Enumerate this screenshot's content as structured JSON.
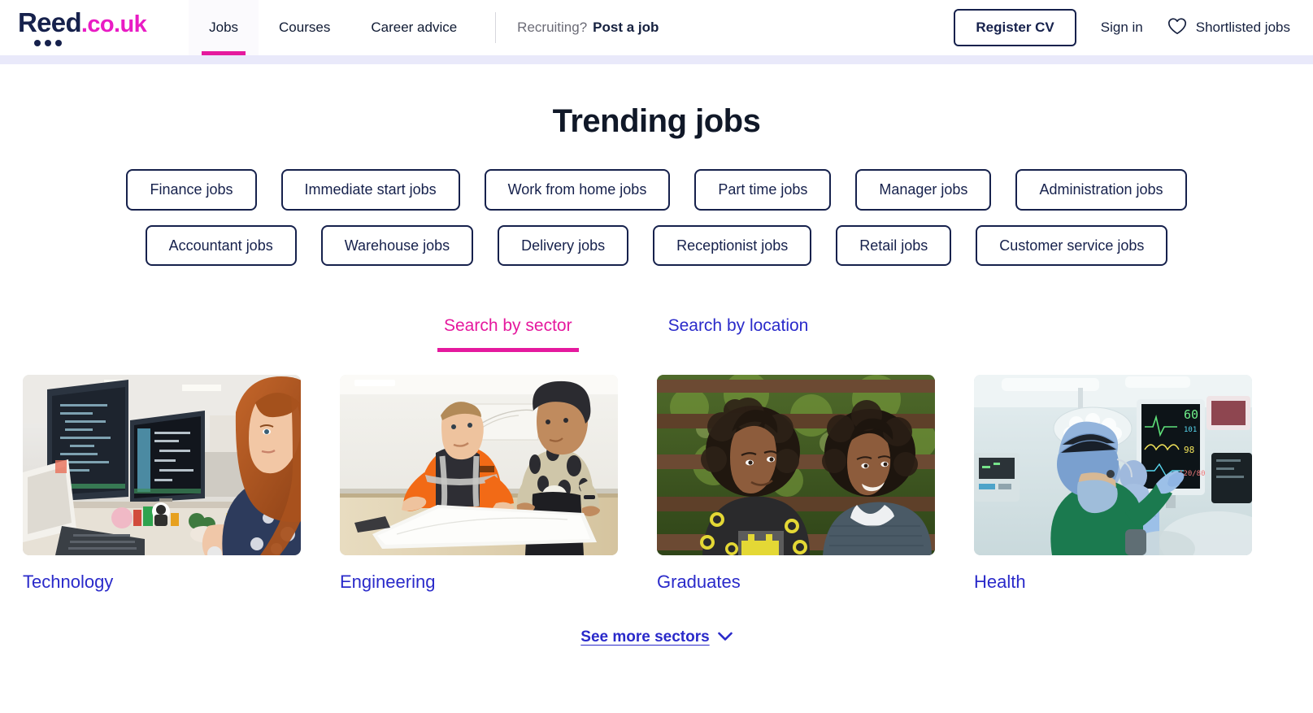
{
  "header": {
    "logo": {
      "brand": "Reed",
      "tld": ".co.uk",
      "dots_icon": "three-dots-icon"
    },
    "nav": [
      {
        "label": "Jobs",
        "active": true
      },
      {
        "label": "Courses",
        "active": false
      },
      {
        "label": "Career advice",
        "active": false
      }
    ],
    "recruiting": {
      "prompt": "Recruiting?",
      "link": "Post a job"
    },
    "register_cv": "Register CV",
    "sign_in": "Sign in",
    "shortlisted": {
      "label": "Shortlisted jobs",
      "icon": "heart-icon"
    }
  },
  "trending": {
    "title": "Trending jobs",
    "rows": [
      [
        "Finance jobs",
        "Immediate start jobs",
        "Work from home jobs",
        "Part time jobs",
        "Manager jobs",
        "Administration jobs"
      ],
      [
        "Accountant jobs",
        "Warehouse jobs",
        "Delivery jobs",
        "Receptionist jobs",
        "Retail jobs",
        "Customer service jobs"
      ]
    ]
  },
  "tabs": [
    {
      "label": "Search by sector",
      "active": true
    },
    {
      "label": "Search by location",
      "active": false
    }
  ],
  "sectors": [
    {
      "label": "Technology",
      "image": "woman-at-dual-monitors-photo"
    },
    {
      "label": "Engineering",
      "image": "engineers-reviewing-blueprints-photo"
    },
    {
      "label": "Graduates",
      "image": "two-graduates-on-bench-photo"
    },
    {
      "label": "Health",
      "image": "surgical-team-operating-theatre-photo"
    }
  ],
  "see_more": {
    "label": "See more sectors",
    "icon": "chevron-down-icon"
  },
  "colors": {
    "brand_navy": "#16214c",
    "brand_magenta": "#e5199e",
    "link_indigo": "#2a2aca",
    "header_band": "#e9e9fa"
  }
}
